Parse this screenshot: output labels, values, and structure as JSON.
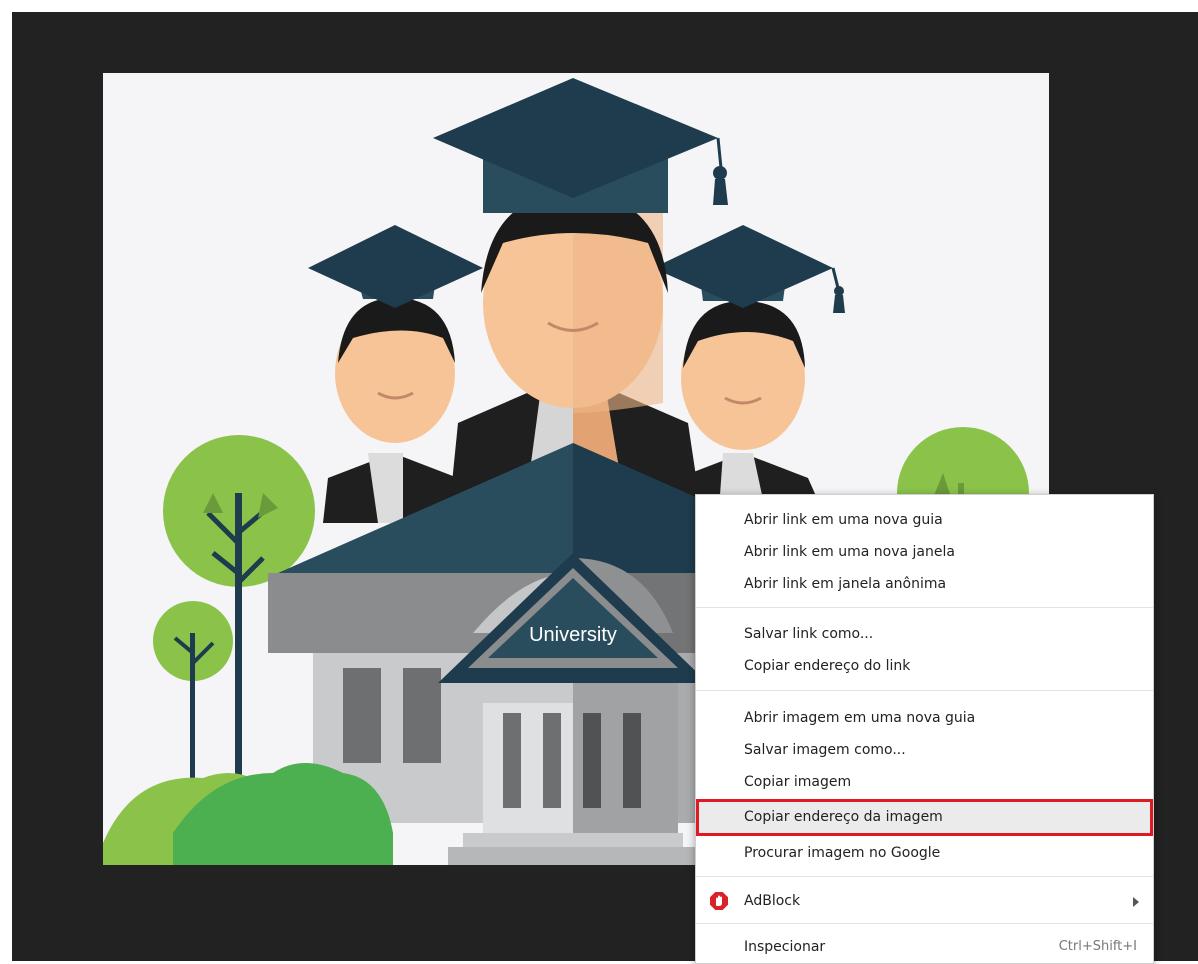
{
  "image": {
    "label": "University"
  },
  "context_menu": {
    "items": [
      {
        "label": "Abrir link em uma nova guia"
      },
      {
        "label": "Abrir link em uma nova janela"
      },
      {
        "label": "Abrir link em janela anônima"
      },
      {
        "label": "Salvar link como..."
      },
      {
        "label": "Copiar endereço do link"
      },
      {
        "label": "Abrir imagem em uma nova guia"
      },
      {
        "label": "Salvar imagem como..."
      },
      {
        "label": "Copiar imagem"
      },
      {
        "label": "Copiar endereço da imagem",
        "highlighted": true
      },
      {
        "label": "Procurar imagem no Google"
      },
      {
        "label": "AdBlock",
        "icon": "adblock-icon",
        "submenu": true
      },
      {
        "label": "Inspecionar",
        "shortcut": "Ctrl+Shift+I"
      }
    ]
  },
  "colors": {
    "background": "#222222",
    "highlight_border": "#e01a22",
    "cap": "#1e3c4d",
    "skin": "#f6c497",
    "tree_green": "#8bc34a",
    "bush_green": "#4caf50"
  }
}
